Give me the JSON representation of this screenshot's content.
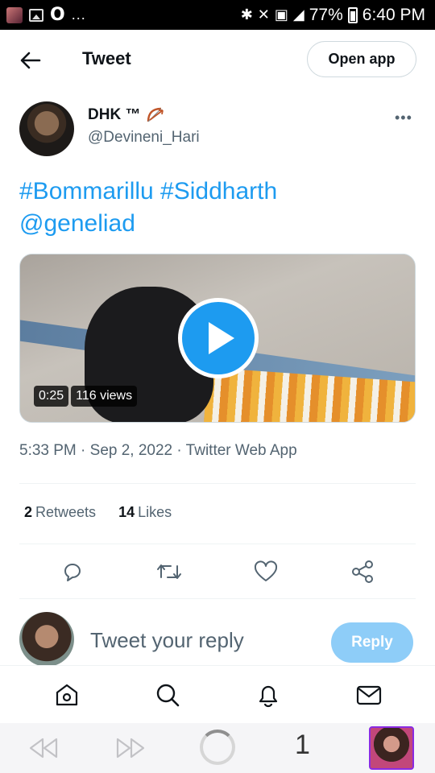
{
  "status_bar": {
    "left_more": "...",
    "battery": "77%",
    "time": "6:40 PM"
  },
  "header": {
    "title": "Tweet",
    "open_app_label": "Open app"
  },
  "author": {
    "name": "DHK ™",
    "handle": "@Devineni_Hari",
    "more_label": "•••"
  },
  "tweet": {
    "text_line1": "#Bommarillu #Siddharth",
    "text_line2": "@geneliad",
    "video": {
      "duration": "0:25",
      "views": "116 views"
    },
    "timestamp": "5:33 PM · Sep 2, 2022 · Twitter Web App",
    "retweets_count": "2",
    "retweets_label": "Retweets",
    "likes_count": "14",
    "likes_label": "Likes"
  },
  "reply": {
    "placeholder": "Tweet your reply",
    "button_label": "Reply"
  },
  "browser": {
    "tab_count": "1"
  },
  "colors": {
    "accent": "#1d9bf0",
    "accent_disabled": "#8ecdf8",
    "secondary_text": "#536471"
  }
}
